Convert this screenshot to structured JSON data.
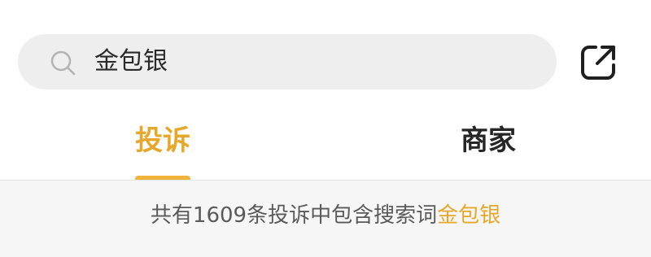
{
  "search": {
    "query": "金包银",
    "icon": "search-icon"
  },
  "header": {
    "share_icon": "share-external-icon"
  },
  "tabs": [
    {
      "label": "投诉",
      "active": true
    },
    {
      "label": "商家",
      "active": false
    }
  ],
  "result": {
    "prefix": "共有1609条投诉中包含搜索词",
    "keyword": "金包银"
  },
  "colors": {
    "accent": "#e6a82b",
    "search_bg": "#eeeeee",
    "result_bg": "#f6f6f6"
  }
}
